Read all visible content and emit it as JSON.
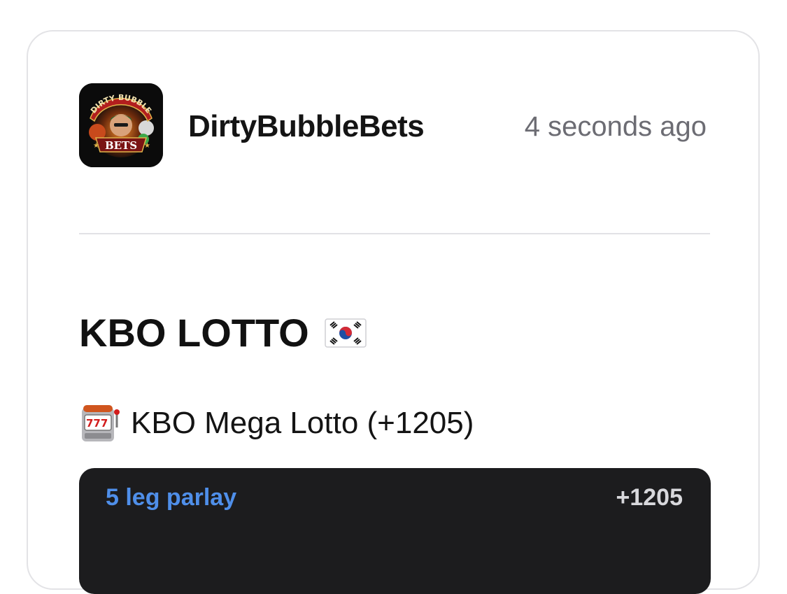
{
  "post": {
    "author": "DirtyBubbleBets",
    "timestamp": "4 seconds ago",
    "avatar": {
      "logo_text_top": "DIRTY BUBBLE",
      "logo_text_bottom": "BETS"
    },
    "title": "KBO LOTTO",
    "title_icon": "south-korea-flag-icon",
    "pick_icon": "slot-machine-icon",
    "pick_text": "KBO Mega Lotto (+1205)"
  },
  "bet_slip": {
    "label": "5 leg parlay",
    "odds": "+1205"
  },
  "colors": {
    "accent_blue": "#4f8fea",
    "slip_background": "#1c1c1e",
    "timestamp_gray": "#6c6c73"
  }
}
